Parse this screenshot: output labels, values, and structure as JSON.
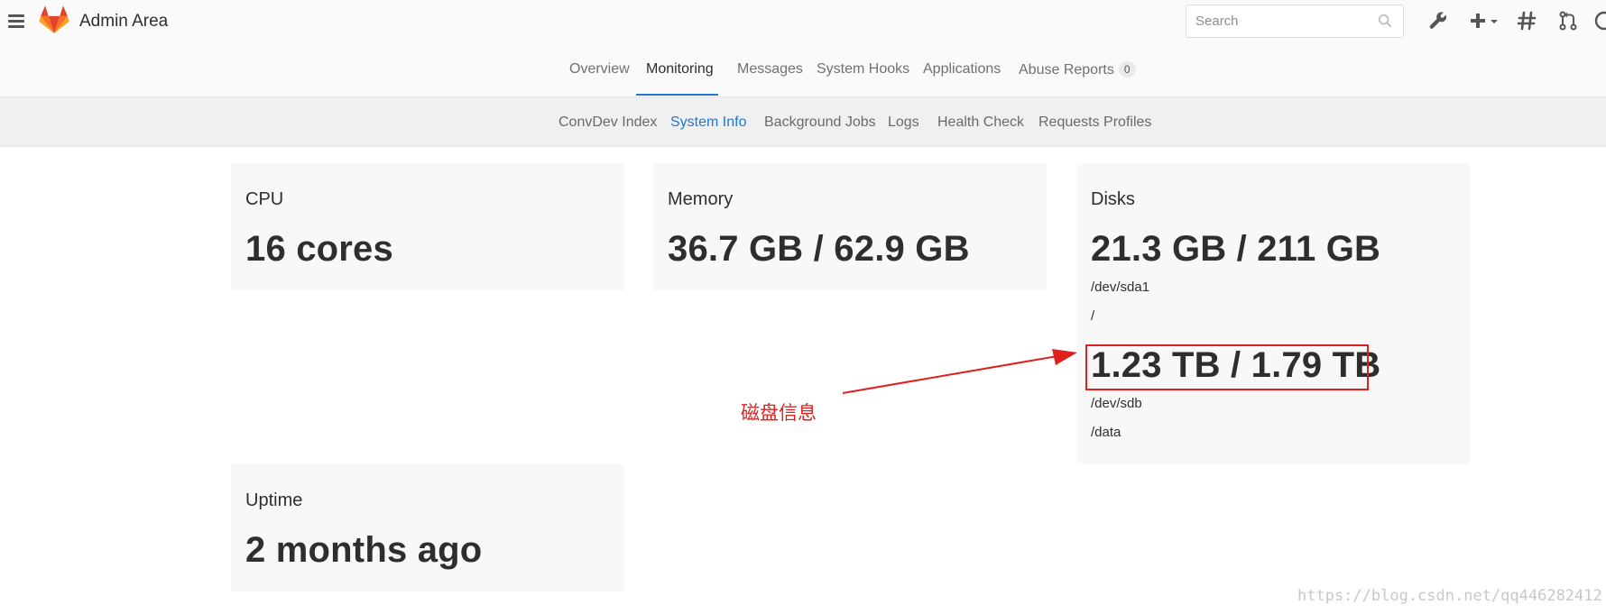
{
  "header": {
    "app_title": "Admin Area",
    "search": {
      "placeholder": "Search",
      "value": ""
    },
    "icons": [
      "menu-icon",
      "gitlab-logo",
      "search-icon",
      "wrench-icon",
      "plus-icon",
      "chevron-down-icon",
      "hash-icon",
      "merge-request-icon"
    ]
  },
  "primary_tabs": [
    {
      "label": "Overview",
      "active": false
    },
    {
      "label": "Monitoring",
      "active": true
    },
    {
      "label": "Messages",
      "active": false
    },
    {
      "label": "System Hooks",
      "active": false
    },
    {
      "label": "Applications",
      "active": false
    },
    {
      "label": "Abuse Reports",
      "active": false,
      "badge": "0"
    }
  ],
  "secondary_tabs": [
    {
      "label": "ConvDev Index",
      "active": false
    },
    {
      "label": "System Info",
      "active": true
    },
    {
      "label": "Background Jobs",
      "active": false
    },
    {
      "label": "Logs",
      "active": false
    },
    {
      "label": "Health Check",
      "active": false
    },
    {
      "label": "Requests Profiles",
      "active": false
    }
  ],
  "cards": {
    "cpu": {
      "title": "CPU",
      "value": "16 cores"
    },
    "memory": {
      "title": "Memory",
      "value": "36.7 GB / 62.9 GB"
    },
    "disks": {
      "title": "Disks",
      "entries": [
        {
          "usage": "21.3 GB / 211 GB",
          "device": "/dev/sda1",
          "mount": "/"
        },
        {
          "usage": "1.23 TB / 1.79 TB",
          "device": "/dev/sdb",
          "mount": "/data"
        }
      ]
    },
    "uptime": {
      "title": "Uptime",
      "value": "2 months ago"
    }
  },
  "annotation": {
    "label": "磁盘信息"
  },
  "watermark": "https://blog.csdn.net/qq446282412",
  "colors": {
    "accent": "#1f78d1",
    "annotation": "#e01f1f",
    "card_bg": "#f8f8f8",
    "logo": "#fc6d26"
  }
}
